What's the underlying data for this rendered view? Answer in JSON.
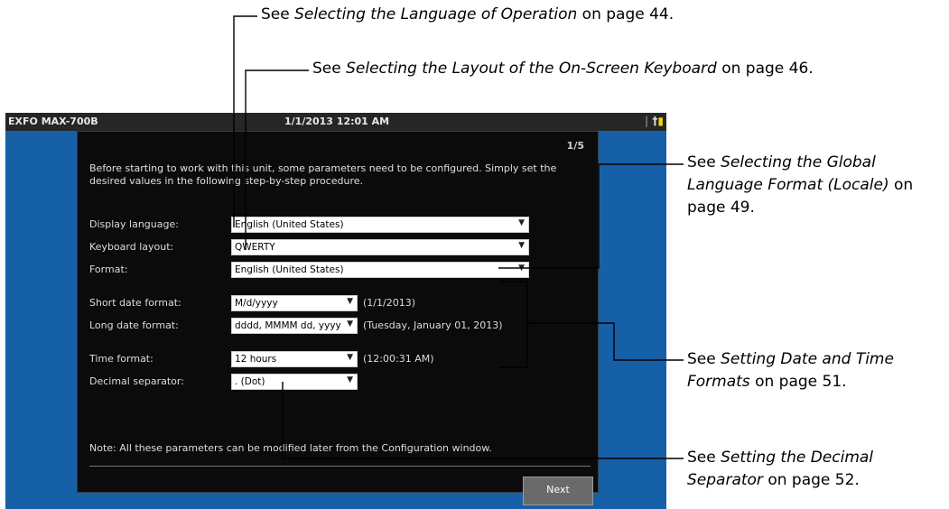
{
  "callouts": {
    "language": {
      "prefix": "See ",
      "title": "Selecting the Language of Operation",
      "suffix": " on page 44."
    },
    "keyboard": {
      "prefix": "See ",
      "title": "Selecting the Layout of the On-Screen Keyboard",
      "suffix": " on page 46."
    },
    "locale": {
      "prefix": "See ",
      "title_line1": "Selecting the Global",
      "title_line2": "Language Format (Locale)",
      "suffix_line2": " on",
      "line3": "page 49."
    },
    "datetime": {
      "prefix": "See ",
      "title_line1": "Setting Date and Time",
      "title_line2": "Formats",
      "suffix_line2": " on page 51."
    },
    "decimal": {
      "prefix": "See ",
      "title_line1": "Setting the Decimal",
      "title_line2": "Separator",
      "suffix_line2": " on page 52."
    }
  },
  "device": {
    "titlebar": {
      "app_name": "EXFO MAX-700B",
      "datetime": "1/1/2013 12:01 AM",
      "tray_separator": "|",
      "usb_icon": "†",
      "battery_icon": "▮"
    },
    "dialog": {
      "page_indicator": "1/5",
      "intro": "Before starting to work with this unit, some parameters need to be configured.  Simply set the desired values in the following step-by-step procedure.",
      "fields": {
        "display_language": {
          "label": "Display language:",
          "value": "English (United States)"
        },
        "keyboard_layout": {
          "label": "Keyboard layout:",
          "value": "QWERTY"
        },
        "format": {
          "label": "Format:",
          "value": "English (United States)"
        },
        "short_date": {
          "label": "Short date format:",
          "value": "M/d/yyyy",
          "preview": "(1/1/2013)"
        },
        "long_date": {
          "label": "Long date format:",
          "value": "dddd, MMMM dd, yyyy",
          "preview": "(Tuesday, January 01, 2013)"
        },
        "time_format": {
          "label": "Time format:",
          "value": "12 hours",
          "preview": "(12:00:31 AM)"
        },
        "decimal_separator": {
          "label": "Decimal separator:",
          "value": ". (Dot)"
        }
      },
      "dropdown_arrow": "▼",
      "note": "Note: All these parameters can be modified later from the Configuration window.",
      "next_label": "Next"
    }
  },
  "colors": {
    "screen_background": "#1660a8",
    "dialog_background": "#0b0b0b",
    "titlebar": "#262626",
    "battery": "#f2d30f",
    "next_button": "#6a6a6a"
  }
}
